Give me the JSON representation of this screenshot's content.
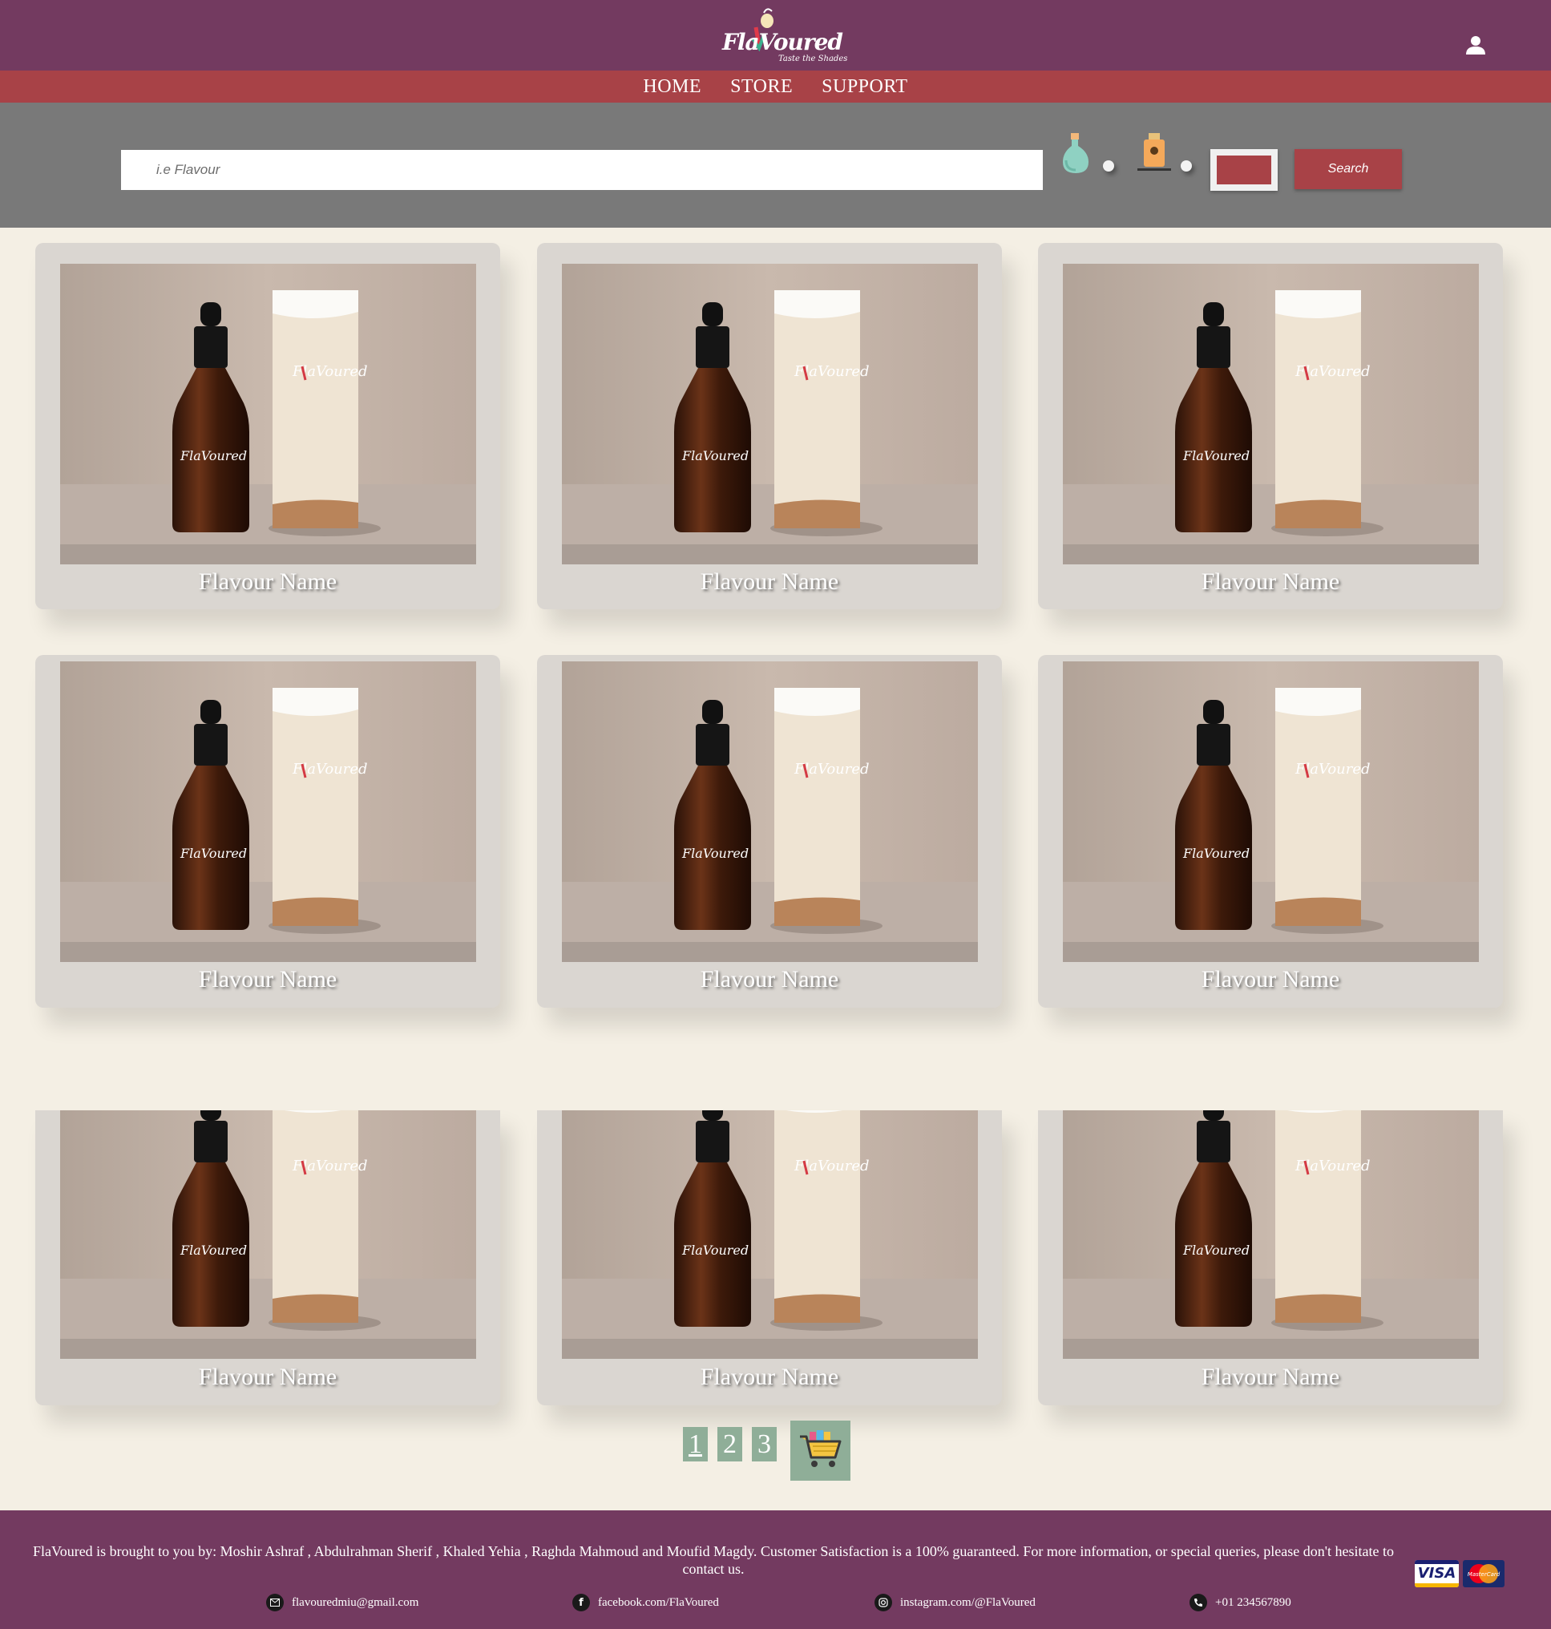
{
  "brand": {
    "name": "FlaVoured",
    "tagline": "Taste the Shades"
  },
  "nav": {
    "items": [
      "HOME",
      "STORE",
      "SUPPORT"
    ]
  },
  "search": {
    "placeholder": "i.e Flavour",
    "button_label": "Search"
  },
  "colors": {
    "header": "#733a60",
    "nav": "#a84247",
    "accent": "#a84247",
    "pager": "#8fae98",
    "page_bg": "#f4efe4"
  },
  "products": [
    {
      "name": "Flavour Name"
    },
    {
      "name": "Flavour Name"
    },
    {
      "name": "Flavour Name"
    },
    {
      "name": "Flavour Name"
    },
    {
      "name": "Flavour Name"
    },
    {
      "name": "Flavour Name"
    },
    {
      "name": "Flavour Name"
    },
    {
      "name": "Flavour Name"
    },
    {
      "name": "Flavour Name"
    }
  ],
  "pagination": {
    "pages": [
      "1",
      "2",
      "3"
    ],
    "current": "1"
  },
  "footer": {
    "credits": "FlaVoured is brought to you by: Moshir Ashraf , Abdulrahman Sherif , Khaled Yehia , Raghda Mahmoud and Moufid Magdy. Customer Satisfaction is a 100% guaranteed. For more information, or special queries, please don't hesitate to contact us.",
    "email": "flavouredmiu@gmail.com",
    "facebook": "facebook.com/FlaVoured",
    "instagram": "instagram.com/@FlaVoured",
    "phone": "+01 234567890",
    "payment": {
      "visa": "VISA",
      "mastercard": "MasterCard"
    }
  }
}
